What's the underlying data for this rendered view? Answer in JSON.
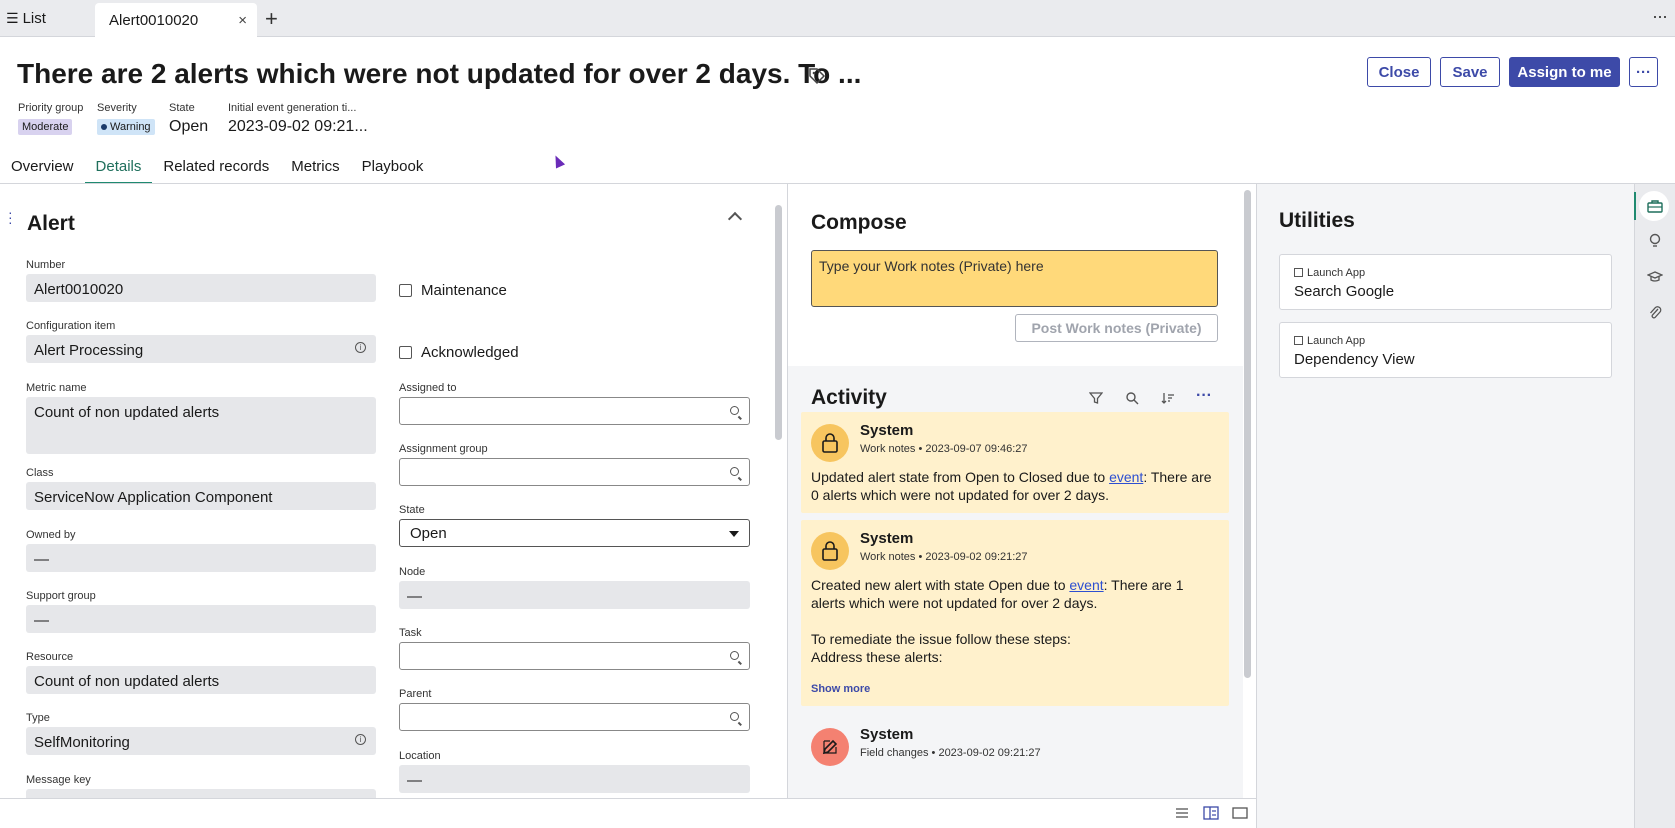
{
  "tabs": {
    "list_label": "List",
    "active_label": "Alert0010020"
  },
  "header": {
    "title": "There are 2 alerts which were not updated for over 2 days. To ...",
    "close_label": "Close",
    "save_label": "Save",
    "assign_label": "Assign to me",
    "more_label": "···"
  },
  "meta": {
    "priority_label": "Priority group",
    "priority_value": "Moderate",
    "severity_label": "Severity",
    "severity_value": "Warning",
    "state_label": "State",
    "state_value": "Open",
    "initial_label": "Initial event generation ti...",
    "initial_value": "2023-09-02 09:21..."
  },
  "nav": [
    "Overview",
    "Details",
    "Related records",
    "Metrics",
    "Playbook"
  ],
  "form": {
    "section_title": "Alert",
    "number_label": "Number",
    "number_value": "Alert0010020",
    "ci_label": "Configuration item",
    "ci_value": "Alert Processing",
    "metric_label": "Metric name",
    "metric_value": "Count of non updated alerts",
    "class_label": "Class",
    "class_value": "ServiceNow Application Component",
    "owned_label": "Owned by",
    "owned_value": "—",
    "support_label": "Support group",
    "support_value": "—",
    "resource_label": "Resource",
    "resource_value": "Count of non updated alerts",
    "type_label": "Type",
    "type_value": "SelfMonitoring",
    "msgkey_label": "Message key",
    "maintenance_label": "Maintenance",
    "acknowledged_label": "Acknowledged",
    "assigned_label": "Assigned to",
    "group_label": "Assignment group",
    "state_label": "State",
    "state_value": "Open",
    "node_label": "Node",
    "node_value": "—",
    "task_label": "Task",
    "parent_label": "Parent",
    "location_label": "Location",
    "location_value": "—"
  },
  "compose": {
    "title": "Compose",
    "placeholder": "Type your Work notes (Private) here",
    "post_label": "Post Work notes (Private)"
  },
  "activity": {
    "title": "Activity",
    "entries": [
      {
        "who": "System",
        "sub": "Work notes • 2023-09-07 09:46:27",
        "body_pre": "Updated alert state from Open to Closed due to ",
        "link": "event",
        "body_post": ": There are 0 alerts which were not updated for over 2 days."
      },
      {
        "who": "System",
        "sub": "Work notes • 2023-09-02 09:21:27",
        "body_pre": "Created new alert with state Open due to ",
        "link": "event",
        "body_post": ": There are 1 alerts which were not updated for over 2 days.",
        "line2": "To remediate the issue follow these steps:",
        "line3": "Address these alerts:",
        "show_more": "Show more"
      },
      {
        "who": "System",
        "sub": "Field changes • 2023-09-02 09:21:27"
      }
    ]
  },
  "utilities": {
    "title": "Utilities",
    "cards": [
      {
        "label": "Launch App",
        "name": "Search Google"
      },
      {
        "label": "Launch App",
        "name": "Dependency View"
      }
    ]
  },
  "colors": {
    "primary": "#3d4aa8",
    "accent": "#1f8a70",
    "note": "#ffd97a",
    "card": "#fff1cc"
  }
}
